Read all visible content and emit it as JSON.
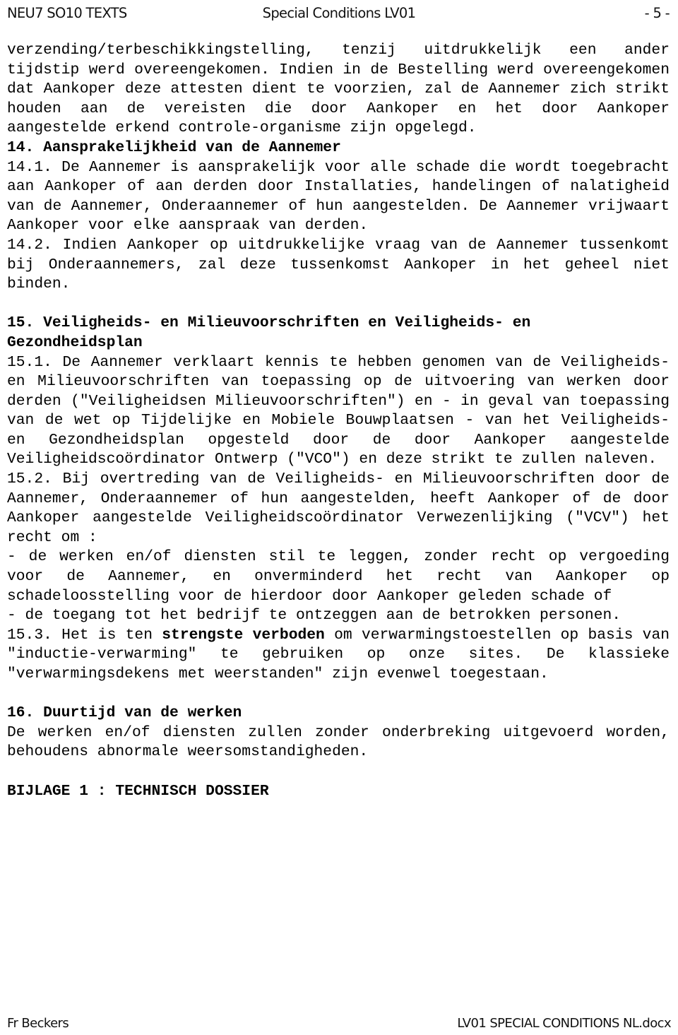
{
  "header": {
    "left": "NEU7 SO10 TEXTS",
    "center": "Special Conditions LV01",
    "page_marker": "- 5 -"
  },
  "footer": {
    "left": "Fr Beckers",
    "right": "LV01 SPECIAL CONDITIONS NL.docx"
  },
  "body": {
    "para_13_continuation": "verzending/terbeschikkingstelling, tenzij uitdrukkelijk een ander tijdstip werd overeengekomen. Indien in de Bestelling werd overeengekomen dat Aankoper deze attesten dient te voorzien, zal de Aannemer zich strikt houden aan de vereisten die door Aankoper en het door Aankoper aangestelde erkend controle-organisme zijn opgelegd.",
    "heading_14": "14. Aansprakelijkheid van de Aannemer",
    "clause_14_1": "14.1. De Aannemer is aansprakelijk voor alle schade die wordt toegebracht aan Aankoper of aan derden door Installaties, handelingen of nalatigheid van de Aannemer, Onderaannemer of hun aangestelden. De Aannemer vrijwaart Aankoper voor elke aanspraak van derden.",
    "clause_14_2": "14.2. Indien Aankoper op uitdrukkelijke vraag van de Aannemer tussenkomt bij Onderaannemers, zal deze tussenkomst Aankoper in het geheel niet binden.",
    "heading_15": "15. Veiligheids- en Milieuvoorschriften en Veiligheids- en Gezondheidsplan",
    "clause_15_1": "15.1. De Aannemer verklaart kennis te hebben genomen van de Veiligheids- en Milieuvoorschriften van toepassing op de uitvoering van werken door derden (\"Veiligheidsen Milieuvoorschriften\") en - in geval van toepassing van de wet op Tijdelijke en Mobiele Bouwplaatsen - van het Veiligheids- en Gezondheidsplan opgesteld door de door Aankoper aangestelde Veiligheidscoördinator Ontwerp (\"VCO\") en deze strikt te zullen naleven.",
    "clause_15_2_intro": "15.2. Bij overtreding van de Veiligheids- en Milieuvoorschriften door de Aannemer, Onderaannemer of hun aangestelden, heeft Aankoper of de door Aankoper aangestelde Veiligheidscoördinator Verwezenlijking (\"VCV\") het recht om :",
    "clause_15_2_bullets": [
      "- de werken en/of diensten stil te leggen, zonder recht op vergoeding voor de Aannemer, en onverminderd het recht van Aankoper op schadeloosstelling voor de hierdoor door Aankoper geleden schade of",
      "- de toegang tot het bedrijf te ontzeggen aan de betrokken personen."
    ],
    "clause_15_3_part1": "15.3. Het is ten ",
    "clause_15_3_bold": "strengste verboden",
    "clause_15_3_part2": " om verwarmingstoestellen op basis van \"inductie-verwarming\" te gebruiken op onze sites.  De klassieke \"verwarmingsdekens met weerstanden\" zijn evenwel toegestaan.",
    "heading_16": "16. Duurtijd van de werken",
    "clause_16_text": "De werken en/of diensten zullen zonder onderbreking uitgevoerd worden, behoudens abnormale weersomstandigheden.",
    "annex_heading": "BIJLAGE 1 : TECHNISCH DOSSIER"
  }
}
